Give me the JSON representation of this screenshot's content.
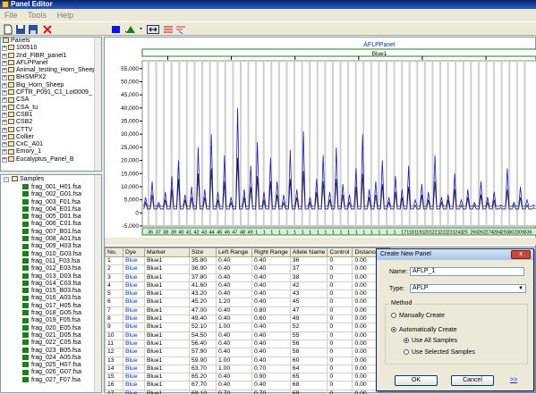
{
  "window": {
    "title": "Panel Editor"
  },
  "menu": [
    "File",
    "Tools",
    "Help"
  ],
  "colors": {
    "trace_blue": "#1c1ca8",
    "trace_dark": "#1a1a40",
    "bin_green": "#2e8b2e",
    "dialog_border": "#0a246a"
  },
  "panels_tree": {
    "root": "Panels",
    "items": [
      "100510",
      "2nd_FIBR_panel1",
      "AFLPPanel",
      "Animal_testing_Horn_Sheep",
      "BHSMPX2",
      "Big_Horn_Sheep",
      "CFTR_P091_C1_Lot0009_",
      "CSA",
      "CSA_tu",
      "CSB1",
      "CSB2",
      "CTTV",
      "Collier",
      "CxC_A01",
      "Emory_1",
      "Eucalyptus_Panel_B"
    ]
  },
  "samples_tree": {
    "root": "Samples",
    "items": [
      "frag_001_H01.fsa",
      "frag_002_G01.fsa",
      "frag_003_F01.fsa",
      "frag_004_E01.fsa",
      "frag_005_D01.fsa",
      "frag_006_C01.fsa",
      "frag_007_B01.fsa",
      "frag_008_A01.fsa",
      "frag_009_H03.fsa",
      "frag_010_G03.fsa",
      "frag_011_F03.fsa",
      "frag_012_E03.fsa",
      "frag_013_D03.fsa",
      "frag_014_C03.fsa",
      "frag_015_B03.fsa",
      "frag_016_A03.fsa",
      "frag_017_H05.fsa",
      "frag_018_G05.fsa",
      "frag_019_F05.fsa",
      "frag_020_E05.fsa",
      "frag_021_D05.fsa",
      "frag_022_C05.fsa",
      "frag_023_B05.fsa",
      "frag_024_A05.fsa",
      "frag_025_H07.fsa",
      "frag_026_G07.fsa",
      "frag_027_F07.fsa"
    ]
  },
  "panel_header": {
    "name": "AFLPPanel",
    "dye": "Blue1"
  },
  "chart_data": {
    "type": "line",
    "x_ticks": [
      50,
      100,
      150,
      200,
      250,
      300
    ],
    "xlim": [
      30,
      340
    ],
    "y_ticks": [
      "55,000",
      "50,000",
      "45,000",
      "40,000",
      "35,000",
      "30,000",
      "25,000",
      "20,000",
      "15,000",
      "10,000",
      "5,000",
      "0",
      "-5,000"
    ],
    "ylim": [
      -5000,
      58000
    ],
    "bin_labels": [
      "36",
      "37",
      "38",
      "39",
      "40",
      "41",
      "42",
      "43",
      "44",
      "45",
      "46",
      "47",
      "48",
      "49",
      "1",
      "1",
      "1",
      "1",
      "1",
      "1",
      "1",
      "1",
      "1",
      "1",
      "1",
      "1",
      "1",
      "1",
      "1",
      "1",
      "1",
      "1",
      "1",
      "171",
      "181",
      "191",
      "201",
      "221",
      "222",
      "231",
      "243",
      "25",
      "260",
      "262",
      "274",
      "284",
      "293",
      "302",
      "309",
      "336"
    ],
    "series": [
      {
        "values": [
          6000,
          12000,
          4000,
          8000,
          14000,
          20000,
          7000,
          10000,
          25000,
          9000,
          30000,
          8000,
          22000,
          6000,
          40000,
          9000,
          18000,
          27000,
          8000,
          21000,
          12000,
          7000,
          24000,
          9000,
          31000,
          6000,
          13000,
          22000,
          8000,
          25000,
          11000,
          7000,
          17000,
          30000,
          9000,
          12000,
          20000,
          6000,
          14000,
          9000,
          18000,
          5000,
          11000,
          8000,
          22000,
          6000,
          7000,
          15000,
          5000,
          9000,
          4000,
          12000,
          6000,
          8000,
          3000,
          17000,
          4000,
          10000,
          5000,
          3000
        ]
      },
      {
        "values": [
          4000,
          7000,
          3000,
          5000,
          9000,
          13000,
          5000,
          6000,
          15000,
          6000,
          17000,
          5000,
          12000,
          4000,
          21000,
          6000,
          10000,
          14000,
          5000,
          12000,
          7000,
          4000,
          13000,
          6000,
          16000,
          4000,
          8000,
          12000,
          5000,
          13000,
          7000,
          4000,
          10000,
          15000,
          6000,
          7000,
          11000,
          4000,
          8000,
          6000,
          10000,
          3000,
          7000,
          5000,
          12000,
          4000,
          5000,
          9000,
          3000,
          6000,
          3000,
          7000,
          4000,
          5000,
          2000,
          9000,
          3000,
          6000,
          3000,
          2000
        ]
      }
    ]
  },
  "table": {
    "columns": [
      "No.",
      "Dye",
      "Marker",
      "Size",
      "Left Range",
      "Right Range",
      "Allele Name",
      "Control",
      "Distance/Ab"
    ],
    "rows": [
      [
        "1",
        "Blue",
        "Blue1",
        "35.80",
        "0.40",
        "0.40",
        "36",
        "0",
        "0.00"
      ],
      [
        "2",
        "Blue",
        "Blue1",
        "36.90",
        "0.40",
        "0.40",
        "37",
        "0",
        "0.00"
      ],
      [
        "3",
        "Blue",
        "Blue1",
        "37.80",
        "0.40",
        "0.40",
        "38",
        "0",
        "0.00"
      ],
      [
        "4",
        "Blue",
        "Blue1",
        "41.60",
        "0.40",
        "0.40",
        "42",
        "0",
        "0.00"
      ],
      [
        "5",
        "Blue",
        "Blue1",
        "43.20",
        "0.40",
        "0.40",
        "43",
        "0",
        "0.00"
      ],
      [
        "6",
        "Blue",
        "Blue1",
        "45.20",
        "1.20",
        "0.40",
        "45",
        "0",
        "0.00"
      ],
      [
        "7",
        "Blue",
        "Blue1",
        "47.00",
        "0.40",
        "0.80",
        "47",
        "0",
        "0.00"
      ],
      [
        "8",
        "Blue",
        "Blue1",
        "49.40",
        "0.40",
        "0.60",
        "49",
        "0",
        "0.00"
      ],
      [
        "9",
        "Blue",
        "Blue1",
        "52.10",
        "1.00",
        "0.40",
        "52",
        "0",
        "0.00"
      ],
      [
        "10",
        "Blue",
        "Blue1",
        "54.50",
        "0.40",
        "0.40",
        "55",
        "0",
        "0.00"
      ],
      [
        "11",
        "Blue",
        "Blue1",
        "56.40",
        "0.40",
        "0.40",
        "56",
        "0",
        "0.00"
      ],
      [
        "12",
        "Blue",
        "Blue1",
        "57.90",
        "0.40",
        "0.40",
        "58",
        "0",
        "0.00"
      ],
      [
        "13",
        "Blue",
        "Blue1",
        "59.90",
        "1.00",
        "0.40",
        "60",
        "0",
        "0.00"
      ],
      [
        "14",
        "Blue",
        "Blue1",
        "63.70",
        "1.00",
        "0.70",
        "64",
        "0",
        "0.00"
      ],
      [
        "15",
        "Blue",
        "Blue1",
        "65.20",
        "0.40",
        "0.90",
        "65",
        "0",
        "0.00"
      ],
      [
        "16",
        "Blue",
        "Blue1",
        "67.70",
        "0.40",
        "0.40",
        "68",
        "0",
        "0.00"
      ],
      [
        "17",
        "Blue",
        "Blue1",
        "69.10",
        "0.70",
        "0.70",
        "69",
        "0",
        "0.00"
      ]
    ]
  },
  "dialog": {
    "title": "Create New Panel",
    "close_label": "x",
    "name_label": "Name:",
    "name_value": "AFLP_1",
    "type_label": "Type:",
    "type_value": "AFLP",
    "method_label": "Method",
    "manual_label": "Manually Create",
    "auto_label": "Automatically Create",
    "all_samples_label": "Use All Samples",
    "selected_samples_label": "Use Selected Samples",
    "ok_label": "OK",
    "cancel_label": "Cancel",
    "more_label": ">>"
  }
}
